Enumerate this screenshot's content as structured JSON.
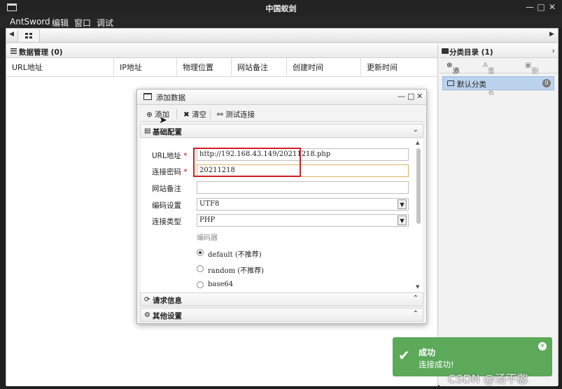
{
  "window": {
    "title": "中国蚁剑"
  },
  "menu": [
    "AntSword",
    "编辑",
    "窗口",
    "调试"
  ],
  "left_panel": {
    "title": "数据管理 (0)",
    "columns": [
      "URL地址",
      "IP地址",
      "物理位置",
      "网站备注",
      "创建时间",
      "更新时间"
    ]
  },
  "right_panel": {
    "title": "分类目录 (1)",
    "toolbar": {
      "add": "添加",
      "rename": "重命名",
      "delete": "删除"
    },
    "categories": [
      {
        "name": "默认分类",
        "count": "0"
      }
    ]
  },
  "dialog": {
    "title": "添加数据",
    "toolbar": {
      "add": "添加",
      "clear": "清空",
      "test": "测试连接"
    },
    "sections": {
      "basic": "基础配置",
      "request": "请求信息",
      "other": "其他设置"
    },
    "form": {
      "url_label": "URL地址",
      "url_value": "http://192.168.43.149/20211218.php",
      "password_label": "连接密码",
      "password_value": "20211218",
      "note_label": "网站备注",
      "note_value": "",
      "encoding_label": "编码设置",
      "encoding_value": "UTF8",
      "type_label": "连接类型",
      "type_value": "PHP",
      "required_mark": "*",
      "encoder_label": "编码器",
      "encoders": [
        {
          "label": "default (不推荐)",
          "selected": true
        },
        {
          "label": "random (不推荐)",
          "selected": false
        },
        {
          "label": "base64",
          "selected": false
        }
      ]
    }
  },
  "toast": {
    "title": "成功",
    "message": "连接成功!"
  },
  "watermark": "CSDN @汤不憨",
  "colors": {
    "toast_bg": "#5ca95a",
    "highlight": "#d21f24",
    "selected_category": "#bcd3ee"
  }
}
